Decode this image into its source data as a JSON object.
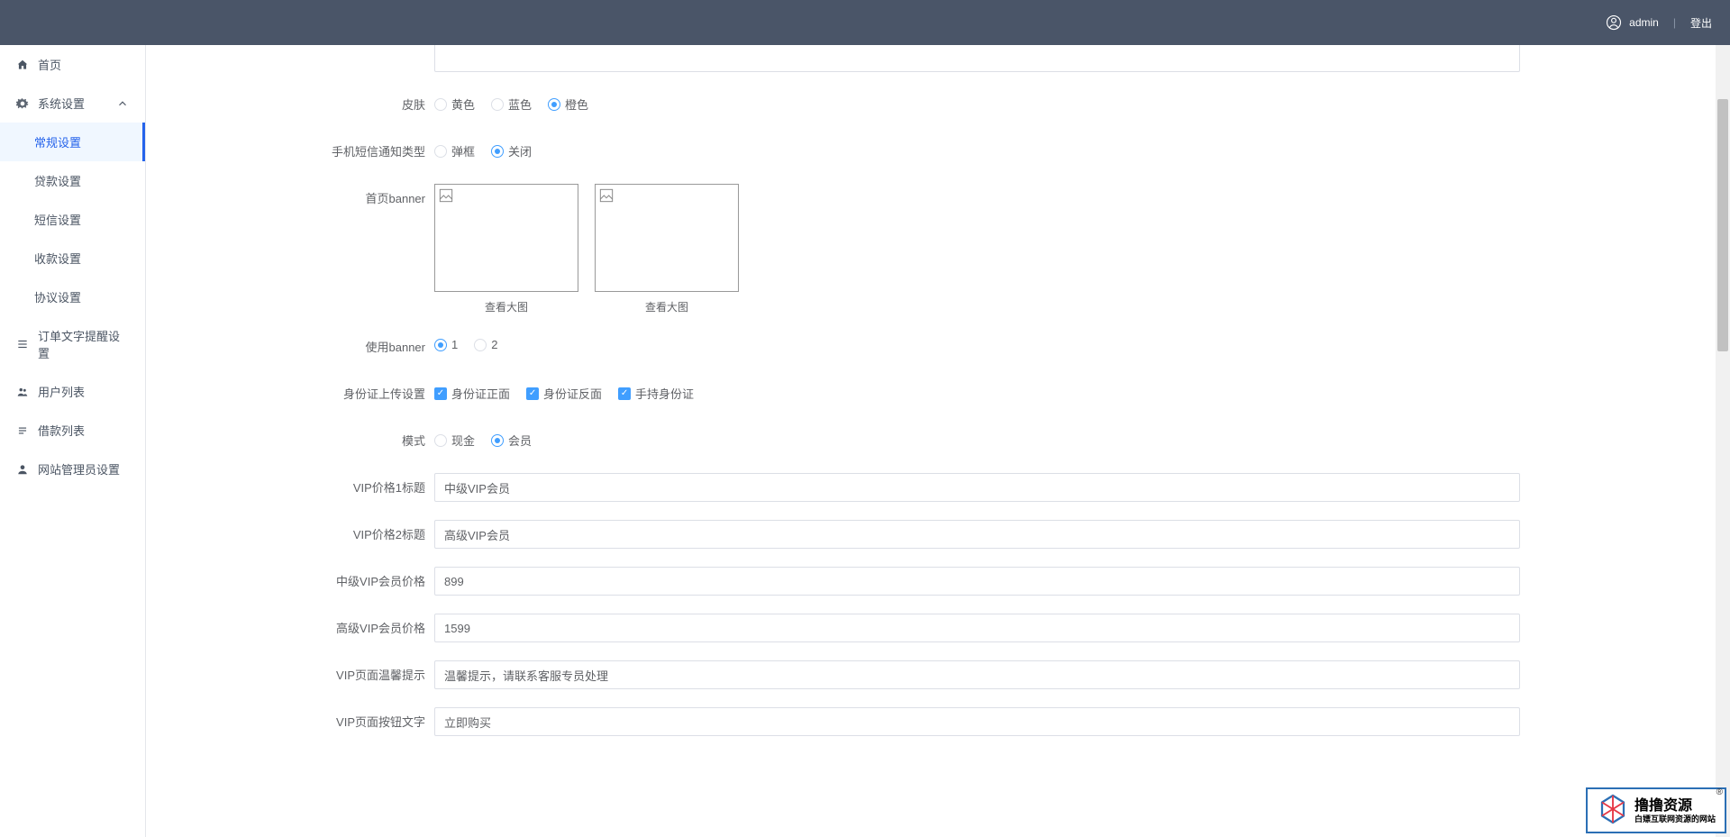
{
  "header": {
    "user": "admin",
    "logout": "登出"
  },
  "sidebar": {
    "home": "首页",
    "system": "系统设置",
    "sub": {
      "general": "常规设置",
      "loan": "贷款设置",
      "sms": "短信设置",
      "payment": "收款设置",
      "agreement": "协议设置"
    },
    "orderText": "订单文字提醒设置",
    "users": "用户列表",
    "loans": "借款列表",
    "admins": "网站管理员设置"
  },
  "form": {
    "topSelect": {
      "label": "",
      "value": ""
    },
    "skin": {
      "label": "皮肤",
      "opts": [
        "黄色",
        "蓝色",
        "橙色"
      ]
    },
    "smsType": {
      "label": "手机短信通知类型",
      "opts": [
        "弹框",
        "关闭"
      ]
    },
    "banner": {
      "label": "首页banner",
      "caption": "查看大图"
    },
    "useBanner": {
      "label": "使用banner",
      "opts": [
        "1",
        "2"
      ]
    },
    "idUpload": {
      "label": "身份证上传设置",
      "opts": [
        "身份证正面",
        "身份证反面",
        "手持身份证"
      ]
    },
    "mode": {
      "label": "模式",
      "opts": [
        "现金",
        "会员"
      ]
    },
    "vip1title": {
      "label": "VIP价格1标题",
      "value": "中级VIP会员"
    },
    "vip2title": {
      "label": "VIP价格2标题",
      "value": "高级VIP会员"
    },
    "midVipPrice": {
      "label": "中级VIP会员价格",
      "value": "899"
    },
    "highVipPrice": {
      "label": "高级VIP会员价格",
      "value": "1599"
    },
    "vipTip": {
      "label": "VIP页面温馨提示",
      "value": "温馨提示，请联系客服专员处理"
    },
    "vipBtnText": {
      "label": "VIP页面按钮文字",
      "value": "立即购买"
    }
  },
  "watermark": {
    "main": "撸撸资源",
    "sub": "白嫖互联网资源的网站"
  }
}
